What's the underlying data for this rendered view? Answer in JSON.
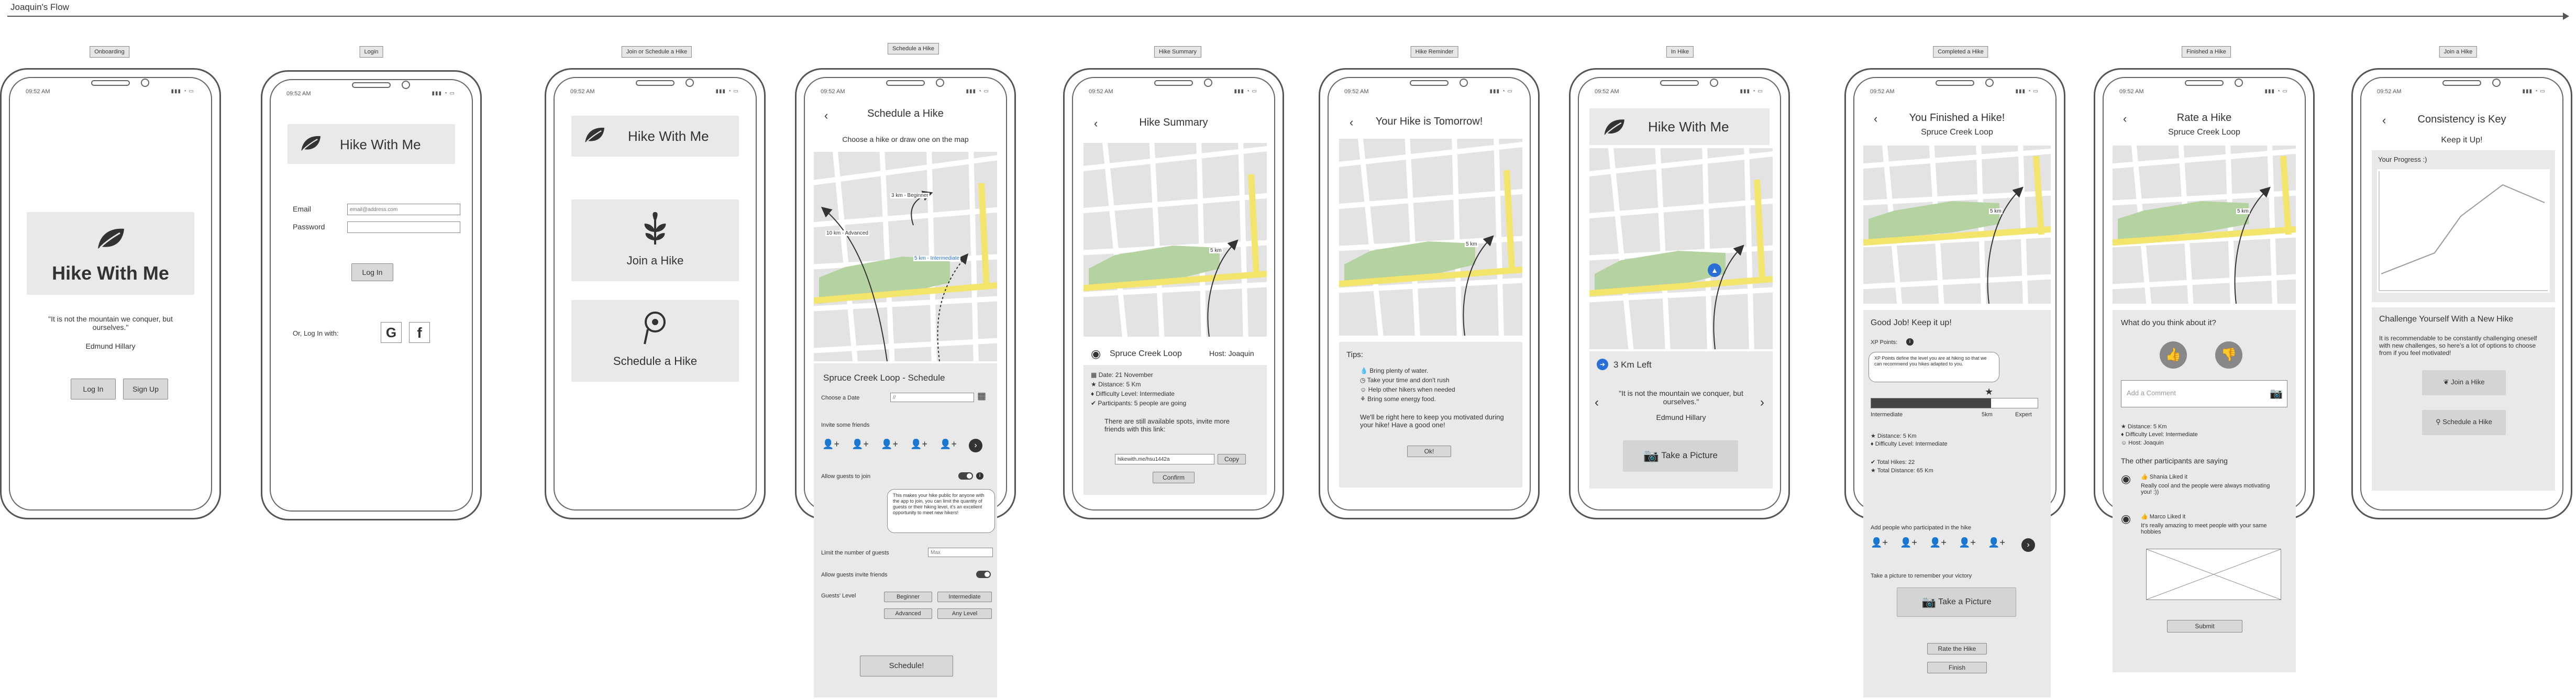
{
  "flow_title": "Joaquin's Flow",
  "status_time": "09:52 AM",
  "screens": {
    "onboarding": {
      "label": "Onboarding",
      "app_name": "Hike With Me",
      "quote": "\"It is not the mountain we conquer, but ourselves.\"",
      "author": "Edmund Hillary",
      "login": "Log In",
      "signup": "Sign Up"
    },
    "login": {
      "label": "Login",
      "app_name": "Hike With Me",
      "email_label": "Email",
      "email_placeholder": "email@address.com",
      "password_label": "Password",
      "login_btn": "Log In",
      "or_login": "Or, Log In with:"
    },
    "join_schedule": {
      "label": "Join or Schedule a Hike",
      "app_name": "Hike With Me",
      "join": "Join a Hike",
      "schedule": "Schedule a Hike"
    },
    "schedule": {
      "label": "Schedule a Hike",
      "title": "Schedule a Hike",
      "subtitle": "Choose a hike or draw one on the map",
      "route_beginner": "3 km - Beginner",
      "route_advanced": "10 km - Advanced",
      "route_intermediate": "5 km - Intermediate",
      "hike_title": "Spruce Creek Loop - Schedule",
      "choose_date": "Choose a Date",
      "date_placeholder": "//",
      "invite_friends": "Invite some friends",
      "allow_guests": "Allow guests to join",
      "tooltip": "This makes your hike public for anyone with the app to join, you can limit the quantity of guests or their hiking level, it's an excellent opportunity to meet new hikers!",
      "limit_guests": "Limit the number of guests",
      "limit_value": "Max",
      "allow_invite": "Allow guests invite friends",
      "guests_level": "Guests' Level",
      "levels": [
        "Beginner",
        "Intermediate",
        "Advanced",
        "Any Level"
      ],
      "schedule_btn": "Schedule!"
    },
    "summary": {
      "label": "Hike Summary",
      "title": "Hike Summary",
      "map_label": "5 km",
      "hike_name": "Spruce Creek Loop",
      "host": "Host: Joaquin",
      "date": "Date: 21 November",
      "distance": "Distance: 5 Km",
      "difficulty": "Difficulty Level: Intermediate",
      "participants": "Participants: 5 people are going",
      "spots_text": "There are still available spots, invite more friends with this link:",
      "link": "hikewith.me/hsu1442a",
      "copy": "Copy",
      "confirm": "Confirm"
    },
    "reminder": {
      "label": "Hike Reminder",
      "title": "Your Hike is Tomorrow!",
      "map_label": "5 km",
      "tips_title": "Tips:",
      "tips": [
        "Bring plenty of water.",
        "Take your time and don't rush",
        "Help other hikers when needed",
        "Bring some energy food."
      ],
      "message": "We'll be right here to keep you motivated during your hike! Have a good one!",
      "ok": "Ok!"
    },
    "inhike": {
      "label": "In Hike",
      "app_name": "Hike With Me",
      "km_left": "3 Km Left",
      "quote": "\"It is not the mountain we conquer, but ourselves.\"",
      "author": "Edmund Hillary",
      "picture": "Take a Picture"
    },
    "completed": {
      "label": "Completed a Hike",
      "title": "You Finished a Hike!",
      "subtitle": "Spruce Creek Loop",
      "map_label": "5 km",
      "good_job": "Good Job! Keep it up!",
      "xp_label": "XP Points:",
      "xp_tip": "XP Points define the level you are at hiking so that we can recommend you hikes adapted to you.",
      "xp_current": "5km",
      "level_left": "Intermediate",
      "level_right": "Expert",
      "xp_fraction": 0.72,
      "distance": "Distance: 5 Km",
      "difficulty": "Difficulty Level: Intermediate",
      "total_hikes": "Total Hikes: 22",
      "total_distance": "Total Distance: 65 Km",
      "add_people": "Add people who participated in the hike",
      "take_picture_text": "Take a picture to remember your victory",
      "picture": "Take a Picture",
      "rate": "Rate the Hike",
      "finish": "Finish"
    },
    "finished": {
      "label": "Finished a Hike",
      "title": "Rate a Hike",
      "subtitle": "Spruce Creek Loop",
      "map_label": "5 km",
      "question": "What do you think about it?",
      "comment_placeholder": "Add a Comment",
      "distance": "Distance: 5 Km",
      "difficulty": "Difficulty Level: Intermediate",
      "host": "Host: Joaquin",
      "others": "The other participants are saying",
      "r1_name": "Shania Liked it",
      "r1_text": "Really cool and the people were always motivating you! :))",
      "r2_name": "Marco Liked it",
      "r2_text": "It's really amazing to meet people with your same hobbies",
      "submit": "Submit"
    },
    "consistency": {
      "label": "Join a Hike",
      "title": "Consistency is Key",
      "subtitle": "Keep it Up!",
      "progress": "Your Progress :)",
      "challenge_title": "Challenge Yourself With a New Hike",
      "challenge_text": "It is recommendable to be constantly challenging oneself with new challenges, so here's a lot of options to choose from if you feel motivated!",
      "join": "Join a Hike",
      "schedule": "Schedule a Hike"
    }
  },
  "colors": {
    "accent_blue": "#2a6fd6",
    "map_green": "#b5d3a0",
    "map_road": "#f3e46c",
    "panel": "#e9e9e9"
  }
}
